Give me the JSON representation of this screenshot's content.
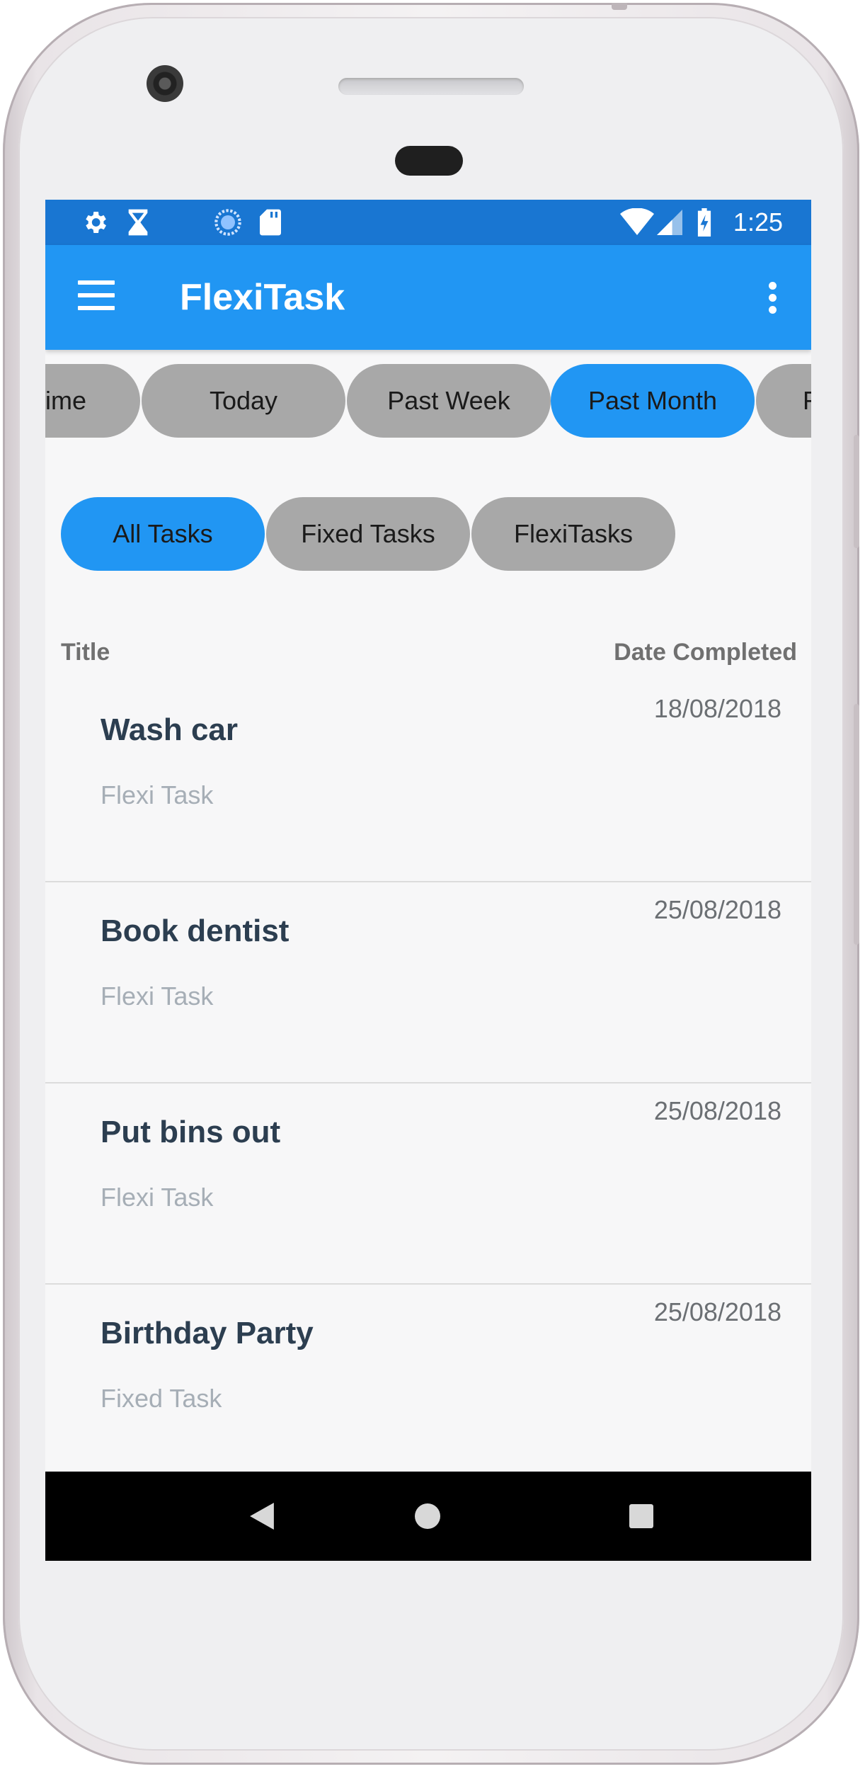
{
  "status_bar": {
    "time": "1:25",
    "left_icons": [
      "gear-icon",
      "hourglass-icon",
      "sync-icon",
      "sd-card-icon"
    ],
    "right_icons": [
      "wifi-icon",
      "signal-icon",
      "battery-charging-icon"
    ]
  },
  "app_bar": {
    "title": "FlexiTask",
    "menu_icon": "hamburger-menu-icon",
    "overflow_icon": "more-vert-icon"
  },
  "period_tabs": [
    {
      "label": "ime",
      "selected": false
    },
    {
      "label": "Today",
      "selected": false
    },
    {
      "label": "Past Week",
      "selected": false
    },
    {
      "label": "Past Month",
      "selected": true
    },
    {
      "label": "F",
      "selected": false
    }
  ],
  "filter_tabs": [
    {
      "label": "All Tasks",
      "selected": true
    },
    {
      "label": "Fixed Tasks",
      "selected": false
    },
    {
      "label": "FlexiTasks",
      "selected": false
    }
  ],
  "table": {
    "col_title": "Title",
    "col_date": "Date Completed",
    "rows": [
      {
        "title": "Wash car",
        "type": "Flexi Task",
        "date": "18/08/2018"
      },
      {
        "title": "Book dentist",
        "type": "Flexi Task",
        "date": "25/08/2018"
      },
      {
        "title": "Put bins out",
        "type": "Flexi Task",
        "date": "25/08/2018"
      },
      {
        "title": "Birthday Party",
        "type": "Fixed Task",
        "date": "25/08/2018"
      }
    ]
  },
  "nav_bar": {
    "icons": [
      "back-icon",
      "home-icon",
      "recents-icon"
    ]
  },
  "colors": {
    "status_bar": "#1976d2",
    "app_bar": "#2196f3",
    "chip_selected": "#2196f3",
    "chip_unselected": "#a8a8a8",
    "task_title": "#2c3e50"
  }
}
